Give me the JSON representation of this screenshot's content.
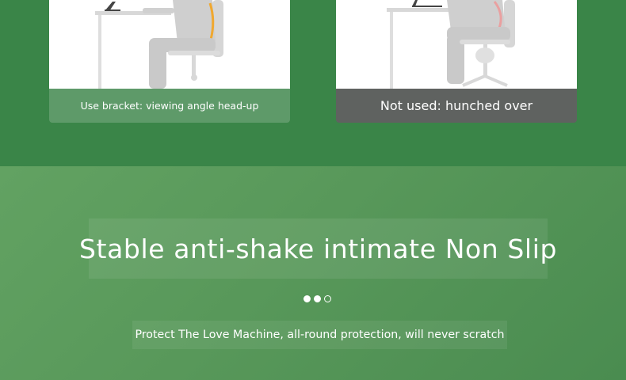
{
  "comparison": {
    "with_bracket": {
      "caption": "Use bracket: viewing angle head-up"
    },
    "without_bracket": {
      "caption": "Not used: hunched over"
    }
  },
  "feature": {
    "headline": "Stable anti-shake intimate Non Slip",
    "carousel": {
      "total_dots": 3,
      "filled_dots": 2
    },
    "description": "Protect The Love Machine, all-round protection, will never scratch"
  },
  "colors": {
    "top_band": "#3a8548",
    "bottom_band": "#5a9a5c",
    "caption_good": "#5e9a69",
    "caption_bad": "#5f6260",
    "figure_grey": "#d4d4d4",
    "spine_highlight": "#f0a830"
  }
}
